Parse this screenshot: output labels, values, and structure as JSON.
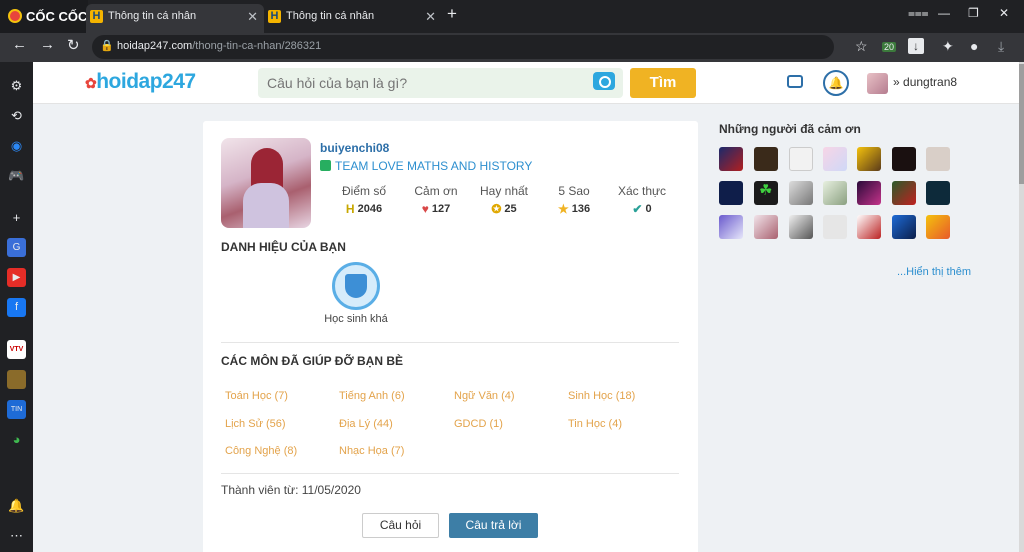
{
  "browser": {
    "brand": "CỐC CỐC",
    "tabs": [
      {
        "title": "Thông tin cá nhân",
        "active": true
      },
      {
        "title": "Thông tin cá nhân",
        "active": false
      }
    ],
    "url_host": "hoidap247.com",
    "url_path": "/thong-tin-ca-nhan/286321",
    "download_badge": "20"
  },
  "site": {
    "logo": "hoidap247",
    "search_placeholder": "Câu hỏi của bạn là gì?",
    "search_button": "Tìm",
    "current_user": "dungtran8"
  },
  "profile": {
    "username": "buiyenchi08",
    "team": "TEAM LOVE MATHS AND HISTORY",
    "stats": [
      {
        "label": "Điểm số",
        "value": "2046",
        "icon": "points-icon"
      },
      {
        "label": "Cảm ơn",
        "value": "127",
        "icon": "heart-icon"
      },
      {
        "label": "Hay nhất",
        "value": "25",
        "icon": "medal-icon"
      },
      {
        "label": "5 Sao",
        "value": "136",
        "icon": "star-icon"
      },
      {
        "label": "Xác thực",
        "value": "0",
        "icon": "verified-icon"
      }
    ],
    "titles_heading": "DANH HIỆU CỦA BẠN",
    "badge_label": "Học sinh khá",
    "subjects_heading": "CÁC MÔN ĐÃ GIÚP ĐỠ BẠN BÈ",
    "subjects": [
      "Toán Học (7)",
      "Tiếng Anh (6)",
      "Ngữ Văn (4)",
      "Sinh Học (18)",
      "Lịch Sử (56)",
      "Địa Lý (44)",
      "GDCD (1)",
      "Tin Học (4)",
      "Công Nghệ (8)",
      "Nhạc Họa (7)"
    ],
    "member_since": "Thành viên từ: 11/05/2020",
    "btn_questions": "Câu hỏi",
    "btn_answers": "Câu trả lời"
  },
  "thanks": {
    "title": "Những người đã cảm ơn",
    "more": "...Hiển thị thêm"
  }
}
